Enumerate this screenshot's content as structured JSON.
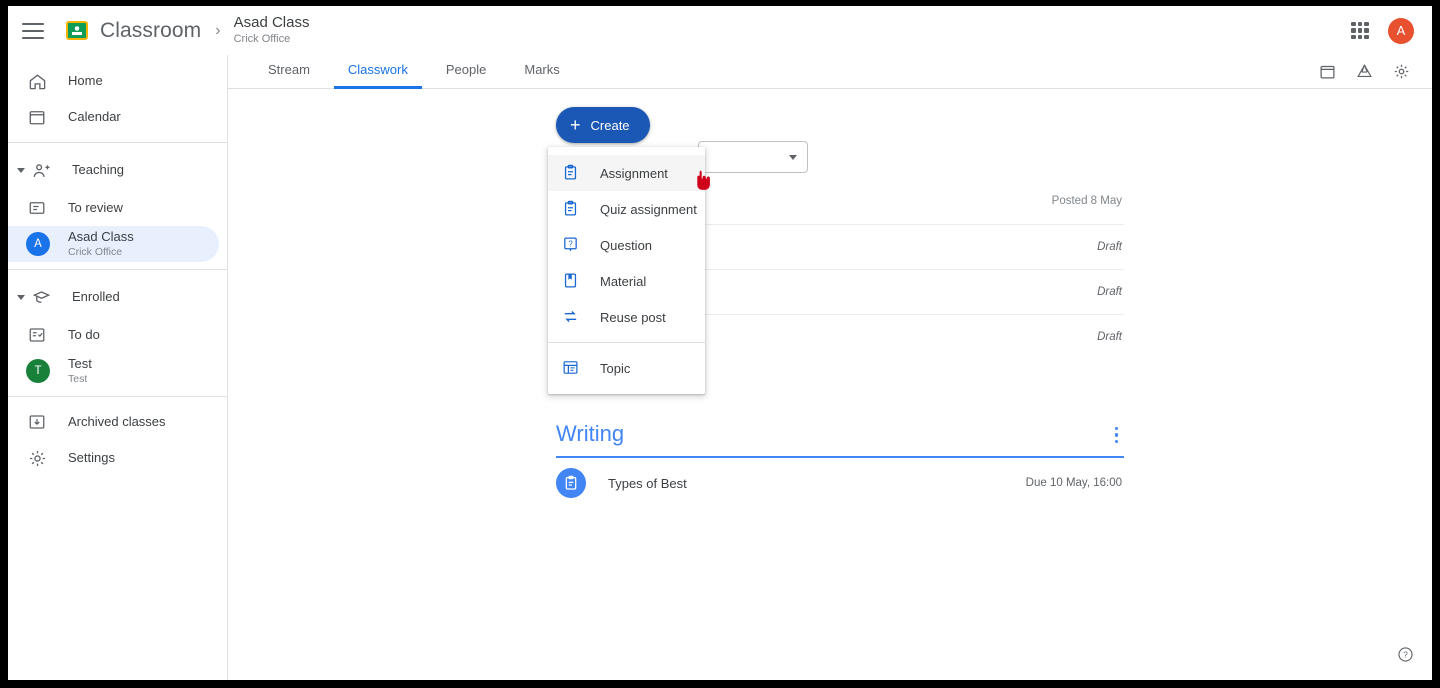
{
  "topbar": {
    "menu_icon": "hamburger-icon",
    "brand": "Classroom",
    "logo_icon": "classroom-logo-icon",
    "separator": "›",
    "breadcrumb_title": "Asad Class",
    "breadcrumb_subtitle": "Crick Office",
    "apps_icon": "apps-grid-icon",
    "avatar_initial": "A",
    "avatar_color": "#e8512f"
  },
  "sidebar": {
    "items": [
      {
        "label": "Home",
        "icon": "home-icon",
        "type": "link"
      },
      {
        "label": "Calendar",
        "icon": "calendar-icon",
        "type": "link"
      },
      {
        "label": "Teaching",
        "icon": "teaching-people-icon",
        "type": "group"
      },
      {
        "label": "To review",
        "icon": "to-review-icon",
        "type": "link"
      },
      {
        "label": "Asad Class",
        "sub": "Crick Office",
        "icon": "class-avatar",
        "initial": "A",
        "avatar_color": "#1a73e8",
        "type": "class",
        "active": true
      },
      {
        "label": "Enrolled",
        "icon": "graduation-cap-icon",
        "type": "group"
      },
      {
        "label": "To do",
        "icon": "to-do-icon",
        "type": "link"
      },
      {
        "label": "Test",
        "sub": "Test",
        "icon": "class-avatar",
        "initial": "T",
        "avatar_color": "#188038",
        "type": "class"
      },
      {
        "label": "Archived classes",
        "icon": "archive-icon",
        "type": "link"
      },
      {
        "label": "Settings",
        "icon": "gear-icon",
        "type": "link"
      }
    ]
  },
  "tabs": [
    {
      "label": "Stream",
      "selected": false
    },
    {
      "label": "Classwork",
      "selected": true
    },
    {
      "label": "People",
      "selected": false
    },
    {
      "label": "Marks",
      "selected": false
    }
  ],
  "tab_actions": [
    {
      "icon": "calendar-icon"
    },
    {
      "icon": "google-drive-icon"
    },
    {
      "icon": "gear-icon"
    }
  ],
  "toolbar": {
    "create_label": "Create",
    "create_icon": "plus-icon",
    "create_color": "#1b58b5",
    "select_value": "",
    "select_icon": "chevron-down-icon"
  },
  "create_menu": {
    "items": [
      {
        "label": "Assignment",
        "icon": "assignment-icon",
        "hover": true
      },
      {
        "label": "Quiz assignment",
        "icon": "quiz-assignment-icon",
        "hover": false
      },
      {
        "label": "Question",
        "icon": "question-icon",
        "hover": false
      },
      {
        "label": "Material",
        "icon": "material-bookmark-icon",
        "hover": false
      },
      {
        "label": "Reuse post",
        "icon": "reuse-post-icon",
        "hover": false
      },
      {
        "label": "Topic",
        "icon": "topic-list-icon",
        "hover": false
      }
    ],
    "icon_color": "#1967d2"
  },
  "classwork": {
    "posted_label": "Posted 8 May",
    "rows": [
      {
        "status": "Draft"
      },
      {
        "status": "Draft"
      },
      {
        "status": "Draft"
      }
    ]
  },
  "topic": {
    "title": "Writing",
    "title_color": "#4285f4",
    "menu_icon": "kebab-menu-icon",
    "items": [
      {
        "title": "Types of Best",
        "due": "Due 10 May, 16:00",
        "icon": "assignment-icon"
      }
    ]
  },
  "help": {
    "icon": "help-circle-icon"
  },
  "cursor": {
    "icon": "pointer-hand-cursor",
    "color": "#d0021b"
  }
}
